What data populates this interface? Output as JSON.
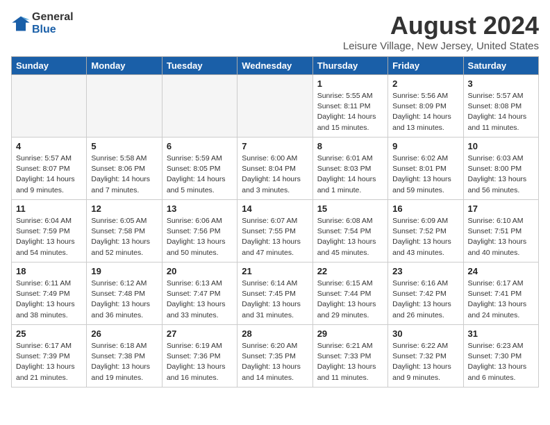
{
  "header": {
    "logo_general": "General",
    "logo_blue": "Blue",
    "month": "August 2024",
    "location": "Leisure Village, New Jersey, United States"
  },
  "weekdays": [
    "Sunday",
    "Monday",
    "Tuesday",
    "Wednesday",
    "Thursday",
    "Friday",
    "Saturday"
  ],
  "weeks": [
    [
      {
        "day": "",
        "empty": true
      },
      {
        "day": "",
        "empty": true
      },
      {
        "day": "",
        "empty": true
      },
      {
        "day": "",
        "empty": true
      },
      {
        "day": "1",
        "sunrise": "5:55 AM",
        "sunset": "8:11 PM",
        "daylight": "14 hours and 15 minutes."
      },
      {
        "day": "2",
        "sunrise": "5:56 AM",
        "sunset": "8:09 PM",
        "daylight": "14 hours and 13 minutes."
      },
      {
        "day": "3",
        "sunrise": "5:57 AM",
        "sunset": "8:08 PM",
        "daylight": "14 hours and 11 minutes."
      }
    ],
    [
      {
        "day": "4",
        "sunrise": "5:57 AM",
        "sunset": "8:07 PM",
        "daylight": "14 hours and 9 minutes."
      },
      {
        "day": "5",
        "sunrise": "5:58 AM",
        "sunset": "8:06 PM",
        "daylight": "14 hours and 7 minutes."
      },
      {
        "day": "6",
        "sunrise": "5:59 AM",
        "sunset": "8:05 PM",
        "daylight": "14 hours and 5 minutes."
      },
      {
        "day": "7",
        "sunrise": "6:00 AM",
        "sunset": "8:04 PM",
        "daylight": "14 hours and 3 minutes."
      },
      {
        "day": "8",
        "sunrise": "6:01 AM",
        "sunset": "8:03 PM",
        "daylight": "14 hours and 1 minute."
      },
      {
        "day": "9",
        "sunrise": "6:02 AM",
        "sunset": "8:01 PM",
        "daylight": "13 hours and 59 minutes."
      },
      {
        "day": "10",
        "sunrise": "6:03 AM",
        "sunset": "8:00 PM",
        "daylight": "13 hours and 56 minutes."
      }
    ],
    [
      {
        "day": "11",
        "sunrise": "6:04 AM",
        "sunset": "7:59 PM",
        "daylight": "13 hours and 54 minutes."
      },
      {
        "day": "12",
        "sunrise": "6:05 AM",
        "sunset": "7:58 PM",
        "daylight": "13 hours and 52 minutes."
      },
      {
        "day": "13",
        "sunrise": "6:06 AM",
        "sunset": "7:56 PM",
        "daylight": "13 hours and 50 minutes."
      },
      {
        "day": "14",
        "sunrise": "6:07 AM",
        "sunset": "7:55 PM",
        "daylight": "13 hours and 47 minutes."
      },
      {
        "day": "15",
        "sunrise": "6:08 AM",
        "sunset": "7:54 PM",
        "daylight": "13 hours and 45 minutes."
      },
      {
        "day": "16",
        "sunrise": "6:09 AM",
        "sunset": "7:52 PM",
        "daylight": "13 hours and 43 minutes."
      },
      {
        "day": "17",
        "sunrise": "6:10 AM",
        "sunset": "7:51 PM",
        "daylight": "13 hours and 40 minutes."
      }
    ],
    [
      {
        "day": "18",
        "sunrise": "6:11 AM",
        "sunset": "7:49 PM",
        "daylight": "13 hours and 38 minutes."
      },
      {
        "day": "19",
        "sunrise": "6:12 AM",
        "sunset": "7:48 PM",
        "daylight": "13 hours and 36 minutes."
      },
      {
        "day": "20",
        "sunrise": "6:13 AM",
        "sunset": "7:47 PM",
        "daylight": "13 hours and 33 minutes."
      },
      {
        "day": "21",
        "sunrise": "6:14 AM",
        "sunset": "7:45 PM",
        "daylight": "13 hours and 31 minutes."
      },
      {
        "day": "22",
        "sunrise": "6:15 AM",
        "sunset": "7:44 PM",
        "daylight": "13 hours and 29 minutes."
      },
      {
        "day": "23",
        "sunrise": "6:16 AM",
        "sunset": "7:42 PM",
        "daylight": "13 hours and 26 minutes."
      },
      {
        "day": "24",
        "sunrise": "6:17 AM",
        "sunset": "7:41 PM",
        "daylight": "13 hours and 24 minutes."
      }
    ],
    [
      {
        "day": "25",
        "sunrise": "6:17 AM",
        "sunset": "7:39 PM",
        "daylight": "13 hours and 21 minutes."
      },
      {
        "day": "26",
        "sunrise": "6:18 AM",
        "sunset": "7:38 PM",
        "daylight": "13 hours and 19 minutes."
      },
      {
        "day": "27",
        "sunrise": "6:19 AM",
        "sunset": "7:36 PM",
        "daylight": "13 hours and 16 minutes."
      },
      {
        "day": "28",
        "sunrise": "6:20 AM",
        "sunset": "7:35 PM",
        "daylight": "13 hours and 14 minutes."
      },
      {
        "day": "29",
        "sunrise": "6:21 AM",
        "sunset": "7:33 PM",
        "daylight": "13 hours and 11 minutes."
      },
      {
        "day": "30",
        "sunrise": "6:22 AM",
        "sunset": "7:32 PM",
        "daylight": "13 hours and 9 minutes."
      },
      {
        "day": "31",
        "sunrise": "6:23 AM",
        "sunset": "7:30 PM",
        "daylight": "13 hours and 6 minutes."
      }
    ]
  ]
}
